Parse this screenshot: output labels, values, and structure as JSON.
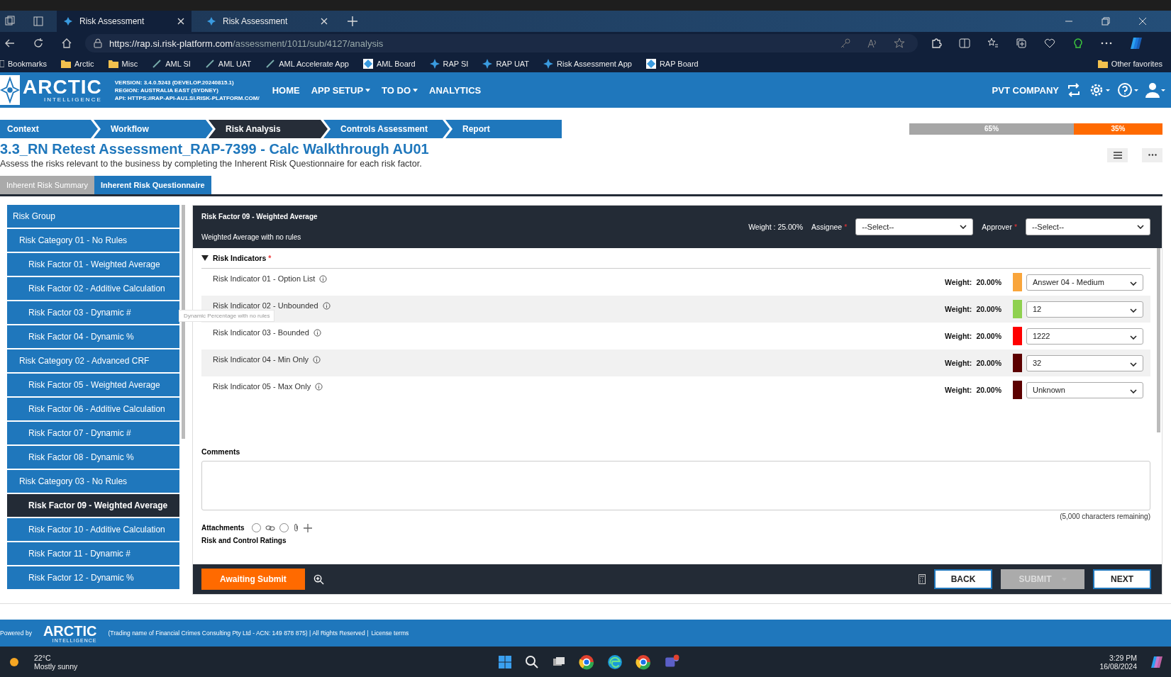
{
  "browser": {
    "tabs": [
      {
        "label": "Risk Assessment",
        "selected": true
      },
      {
        "label": "Risk Assessment",
        "selected": false
      }
    ],
    "url": {
      "host": "https://rap.si.risk-platform.com",
      "path": "/assessment/1011/sub/4127/analysis"
    },
    "bookmarks": [
      {
        "label": "Bookmarks",
        "kind": "book"
      },
      {
        "label": "Arctic",
        "kind": "folder"
      },
      {
        "label": "Misc",
        "kind": "folder"
      },
      {
        "label": "AML SI",
        "kind": "link"
      },
      {
        "label": "AML UAT",
        "kind": "link"
      },
      {
        "label": "AML Accelerate App",
        "kind": "link"
      },
      {
        "label": "AML Board",
        "kind": "board"
      },
      {
        "label": "RAP SI",
        "kind": "star"
      },
      {
        "label": "RAP UAT",
        "kind": "star"
      },
      {
        "label": "Risk Assessment App",
        "kind": "star"
      },
      {
        "label": "RAP Board",
        "kind": "board"
      }
    ],
    "other_favorites": "Other favorites"
  },
  "header": {
    "logo": {
      "name": "ARCTIC",
      "sub": "INTELLIGENCE"
    },
    "info": [
      "VERSION: 3.4.0.5243 (DEVELOP.20240815.1)",
      "REGION: AUSTRALIA EAST (SYDNEY)",
      "API: HTTPS://RAP-API-AU1.SI.RISK-PLATFORM.COM/"
    ],
    "nav": [
      {
        "label": "HOME",
        "has_menu": false
      },
      {
        "label": "APP SETUP",
        "has_menu": true
      },
      {
        "label": "TO DO",
        "has_menu": true
      },
      {
        "label": "ANALYTICS",
        "has_menu": false
      }
    ],
    "company": "PVT COMPANY"
  },
  "steps": [
    {
      "label": "Context",
      "selected": false
    },
    {
      "label": "Workflow",
      "selected": false
    },
    {
      "label": "Risk Analysis",
      "selected": true
    },
    {
      "label": "Controls Assessment",
      "selected": false
    },
    {
      "label": "Report",
      "selected": false
    }
  ],
  "progress": [
    {
      "label": "65%",
      "level": 0.65,
      "color": "#a6a6a6"
    },
    {
      "label": "35%",
      "level": 0.35,
      "color": "#ff6a00"
    }
  ],
  "title": "3.3_RN Retest Assessment_RAP-7399 - Calc Walkthrough AU01",
  "subtitle": "Assess the risks relevant to the business by completing the Inherent Risk Questionnaire for each risk factor.",
  "tabs": [
    {
      "label": "Inherent Risk Summary",
      "selected": false
    },
    {
      "label": "Inherent Risk Questionnaire",
      "selected": true
    }
  ],
  "sidebar": {
    "items": [
      {
        "label": "Risk Group",
        "kind": "group",
        "selected": false
      },
      {
        "label": "Risk Category 01 - No Rules",
        "kind": "category",
        "selected": false
      },
      {
        "label": "Risk Factor 01 - Weighted Average",
        "kind": "factor",
        "selected": false
      },
      {
        "label": "Risk Factor 02 - Additive Calculation",
        "kind": "factor",
        "selected": false
      },
      {
        "label": "Risk Factor 03 - Dynamic #",
        "kind": "factor",
        "selected": false
      },
      {
        "label": "Risk Factor 04 - Dynamic %",
        "kind": "factor",
        "selected": false
      },
      {
        "label": "Risk Category 02 - Advanced CRF",
        "kind": "category",
        "selected": false
      },
      {
        "label": "Risk Factor 05 - Weighted Average",
        "kind": "factor",
        "selected": false
      },
      {
        "label": "Risk Factor 06 - Additive Calculation",
        "kind": "factor",
        "selected": false
      },
      {
        "label": "Risk Factor 07 - Dynamic #",
        "kind": "factor",
        "selected": false
      },
      {
        "label": "Risk Factor 08 - Dynamic %",
        "kind": "factor",
        "selected": false
      },
      {
        "label": "Risk Category 03 - No Rules",
        "kind": "category",
        "selected": false
      },
      {
        "label": "Risk Factor 09 - Weighted Average",
        "kind": "factor",
        "selected": true
      },
      {
        "label": "Risk Factor 10 - Additive Calculation",
        "kind": "factor",
        "selected": false
      },
      {
        "label": "Risk Factor 11 - Dynamic #",
        "kind": "factor",
        "selected": false
      },
      {
        "label": "Risk Factor 12 - Dynamic %",
        "kind": "factor",
        "selected": false
      }
    ],
    "tooltip": "Dynamic Percentage with no rules"
  },
  "factor": {
    "title": "Risk Factor 09 - Weighted Average",
    "description": "Weighted Average with no rules",
    "weight": "Weight : 25.00%",
    "assignee": {
      "label": "Assignee",
      "required_mark": "*",
      "value": "--Select--"
    },
    "approver": {
      "label": "Approver",
      "required_mark": "*",
      "value": "--Select--"
    }
  },
  "indicators": {
    "title": "Risk Indicators",
    "required_mark": "*",
    "expanded": true,
    "items": [
      {
        "name": "Risk Indicator 01 - Option List",
        "weight_label": "Weight:",
        "weight": "20.00%",
        "color": "#f9a53b",
        "value": "Answer 04 - Medium"
      },
      {
        "name": "Risk Indicator 02 - Unbounded",
        "weight_label": "Weight:",
        "weight": "20.00%",
        "color": "#8fd14f",
        "value": "12"
      },
      {
        "name": "Risk Indicator 03 - Bounded",
        "weight_label": "Weight:",
        "weight": "20.00%",
        "color": "#ff0000",
        "value": "1222"
      },
      {
        "name": "Risk Indicator 04 - Min Only",
        "weight_label": "Weight:",
        "weight": "20.00%",
        "color": "#5c0000",
        "value": "32"
      },
      {
        "name": "Risk Indicator 05 - Max Only",
        "weight_label": "Weight:",
        "weight": "20.00%",
        "color": "#5c0000",
        "value": "Unknown"
      }
    ]
  },
  "comments": {
    "label": "Comments",
    "remaining": "(5,000 characters remaining)"
  },
  "attachments": {
    "label": "Attachments",
    "options": [
      {
        "kind": "link",
        "selected": false
      },
      {
        "kind": "file",
        "selected": false
      }
    ]
  },
  "next_section": "Risk and Control Ratings",
  "actions": {
    "status": "Awaiting Submit",
    "buttons": [
      {
        "label": "BACK",
        "disabled": false
      },
      {
        "label": "SUBMIT",
        "disabled": true
      },
      {
        "label": "NEXT",
        "disabled": false
      }
    ]
  },
  "footer": {
    "powered": "Powered by",
    "logo": {
      "name": "ARCTIC",
      "sub": "INTELLIGENCE"
    },
    "legal": "(Trading name of Financial Crimes Consulting Pty Ltd - ACN: 149 878 875) | All Rights Reserved |",
    "link": "License terms"
  },
  "taskbar": {
    "temp": "22°C",
    "weather": "Mostly sunny",
    "time": "3:29 PM",
    "date": "16/08/2024"
  }
}
